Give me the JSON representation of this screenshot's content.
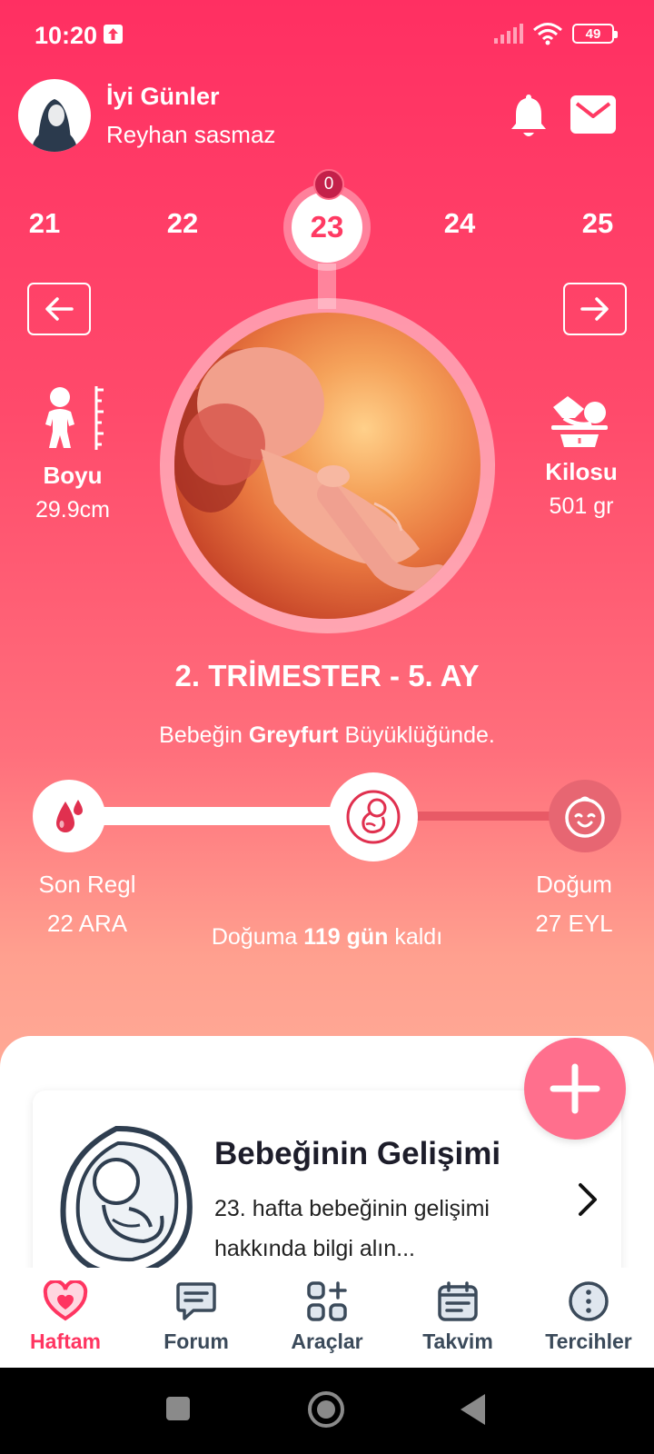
{
  "status_bar": {
    "time": "10:20",
    "battery": "49"
  },
  "header": {
    "greeting": "İyi Günler",
    "user_name": "Reyhan sasmaz"
  },
  "weeks": {
    "prev2": "21",
    "prev1": "22",
    "current": "23",
    "next1": "24",
    "next2": "25",
    "day_badge": "0"
  },
  "baby": {
    "height_label": "Boyu",
    "height_value": "29.9cm",
    "weight_label": "Kilosu",
    "weight_value": "501 gr"
  },
  "trimester": "2. TRİMESTER - 5. AY",
  "size": {
    "prefix": "Bebeğin",
    "fruit": "Greyfurt",
    "suffix": "Büyüklüğünde."
  },
  "progress": {
    "start_label": "Son Regl",
    "start_date": "22 ARA",
    "end_label": "Doğum",
    "end_date": "27 EYL",
    "countdown_prefix": "Doğuma",
    "countdown_value": "119 gün",
    "countdown_suffix": "kaldı",
    "fraction": 0.59
  },
  "card": {
    "title": "Bebeğinin Gelişimi",
    "description": "23. hafta bebeğinin gelişimi hakkında bilgi alın..."
  },
  "tabs": [
    {
      "label": "Haftam",
      "icon": "heart-icon",
      "active": true
    },
    {
      "label": "Forum",
      "icon": "chat-icon",
      "active": false
    },
    {
      "label": "Araçlar",
      "icon": "tools-grid-icon",
      "active": false
    },
    {
      "label": "Takvim",
      "icon": "calendar-icon",
      "active": false
    },
    {
      "label": "Tercihler",
      "icon": "more-icon",
      "active": false
    }
  ],
  "colors": {
    "accent": "#ff3561",
    "fab": "#ff6f8d",
    "badge": "#c4204a"
  }
}
